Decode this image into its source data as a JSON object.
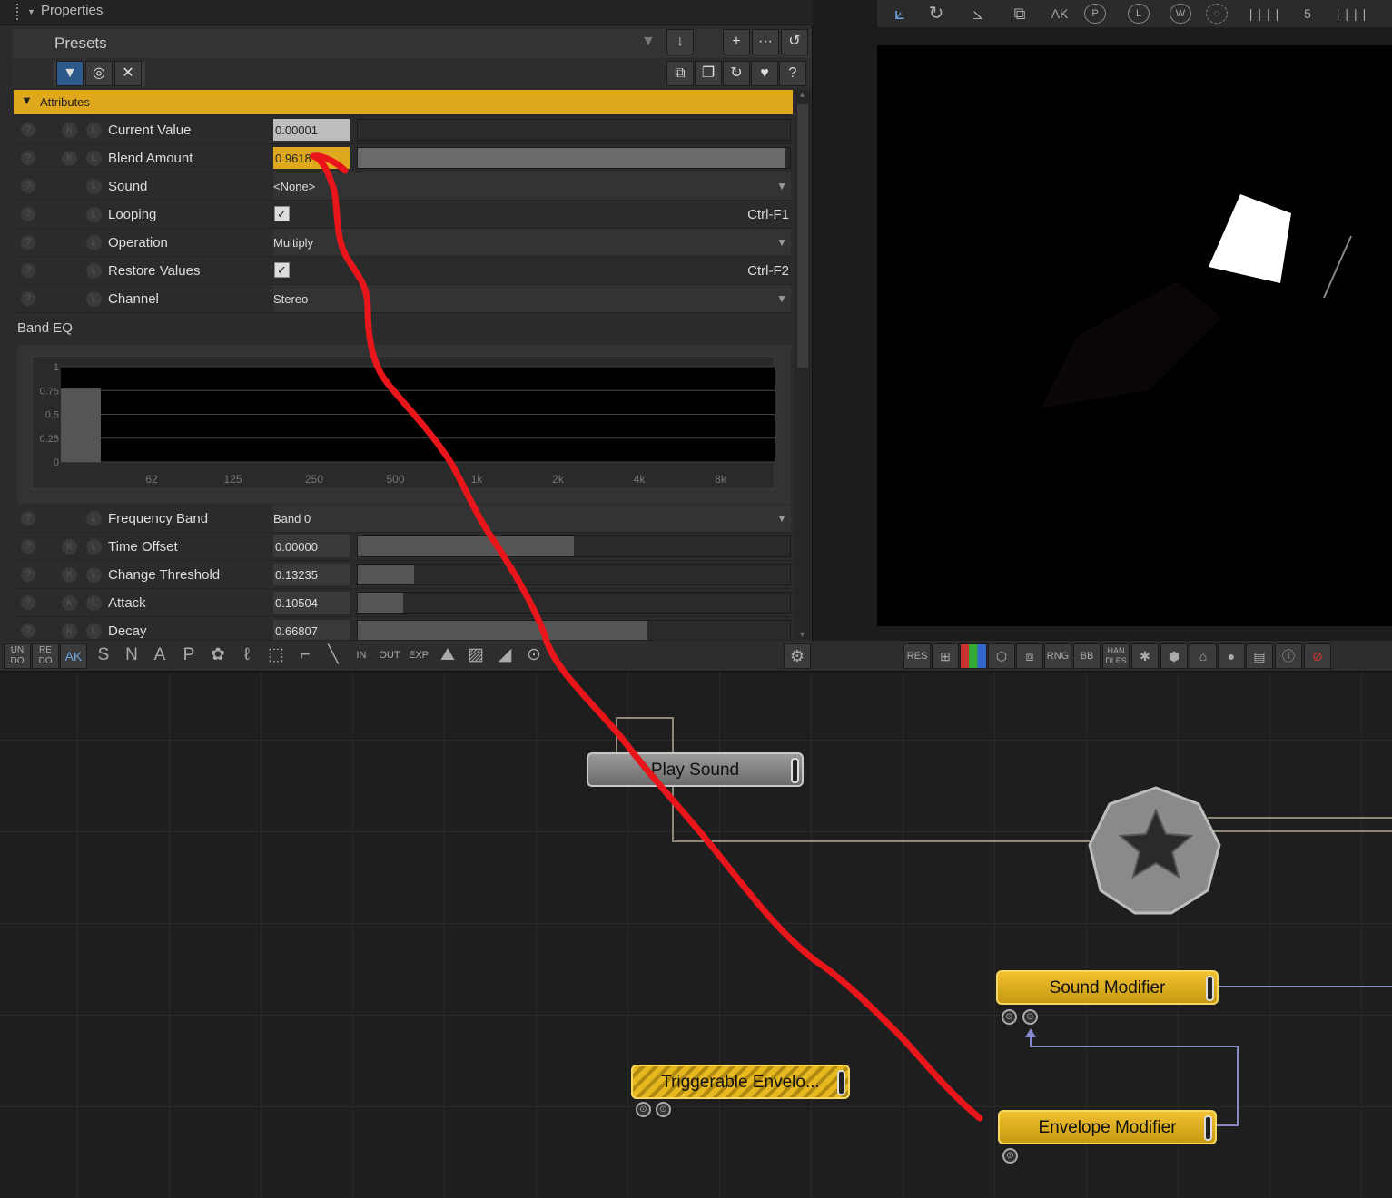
{
  "properties": {
    "title": "Properties",
    "presets_label": "Presets",
    "section_title": "Attributes",
    "rows": [
      {
        "name": "Current Value",
        "value": "0.00001",
        "fill": 0.0
      },
      {
        "name": "Blend Amount",
        "value": "0.9618",
        "fill": 0.99
      },
      {
        "name": "Sound",
        "value": "<None>"
      },
      {
        "name": "Looping",
        "checked": true,
        "shortcut": "Ctrl-F1"
      },
      {
        "name": "Operation",
        "value": "Multiply"
      },
      {
        "name": "Restore Values",
        "checked": true,
        "shortcut": "Ctrl-F2"
      },
      {
        "name": "Channel",
        "value": "Stereo"
      }
    ],
    "band_eq": {
      "title": "Band EQ",
      "y_ticks": [
        "1",
        "0.75",
        "0.5",
        "0.25",
        "0"
      ],
      "x_ticks": [
        "62",
        "125",
        "250",
        "500",
        "1k",
        "2k",
        "4k",
        "8k"
      ],
      "selected_band_level": 0.77
    },
    "rows2": [
      {
        "name": "Frequency Band",
        "value": "Band 0"
      },
      {
        "name": "Time Offset",
        "value": "0.00000",
        "fill": 0.5
      },
      {
        "name": "Change Threshold",
        "value": "0.13235",
        "fill": 0.13
      },
      {
        "name": "Attack",
        "value": "0.10504",
        "fill": 0.105
      },
      {
        "name": "Decay",
        "value": "0.66807",
        "fill": 0.67
      }
    ]
  },
  "viewport_toolbar": {
    "labels": [
      "AK",
      "P",
      "L",
      "W",
      "5"
    ]
  },
  "graph_toolbar": {
    "left": [
      "UN DO",
      "RE DO",
      "AK",
      "S",
      "N",
      "A",
      "P",
      "IN",
      "OUT",
      "EXP"
    ],
    "right": [
      "RES",
      "RNG",
      "BB",
      "HAN DLES"
    ]
  },
  "nodes": {
    "play_sound": "Play  Sound",
    "sound_modifier": "Sound  Modifier",
    "triggerable_envelope": "Triggerable  Envelo...",
    "envelope_modifier": "Envelope  Modifier"
  },
  "colors": {
    "accent": "#e0a81c",
    "link": "#8888cc",
    "annotation": "#e8161a"
  }
}
